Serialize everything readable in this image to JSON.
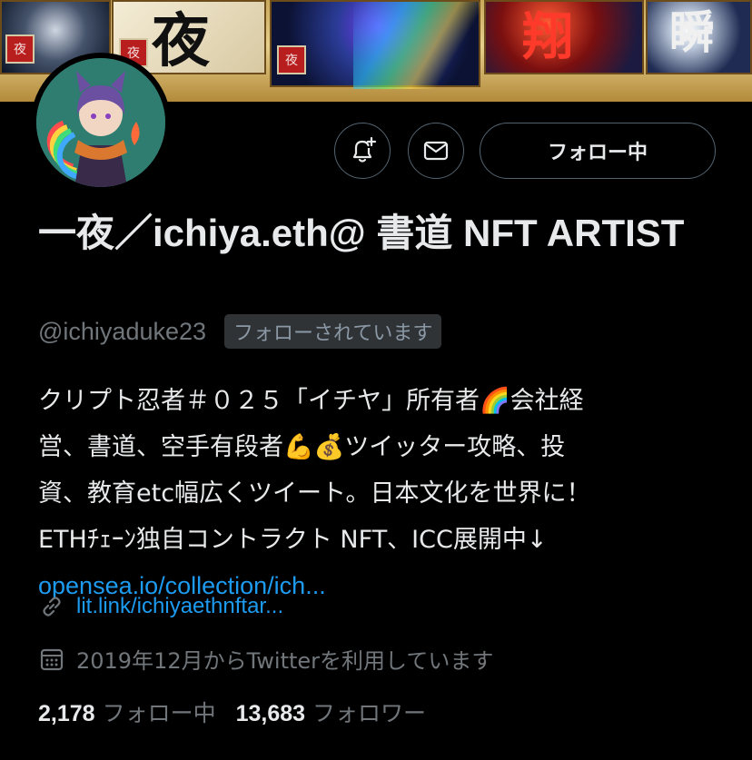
{
  "banner": {
    "glyphs": [
      "夜",
      "翔",
      "瞬"
    ],
    "seal_text": "夜"
  },
  "actions": {
    "notify_icon": "bell-plus-icon",
    "message_icon": "envelope-icon",
    "follow_label": "フォロー中"
  },
  "profile": {
    "name": "一夜／ichiya.eth@ 書道 NFT ARTIST",
    "handle": "@ichiyaduke23",
    "follows_you": "フォローされています",
    "bio_lines": [
      "クリプト忍者＃０２５「イチヤ」所有者🌈会社経",
      "営、書道、空手有段者💪💰ツイッター攻略、投",
      "資、教育etc幅広くツイート。日本文化を世界に！",
      "ETHﾁｪｰﾝ独自コントラクト NFT、ICC展開中↓"
    ],
    "bio_link": "opensea.io/collection/ich...",
    "website": "lit.link/ichiyaethnftar...",
    "joined": "2019年12月からTwitterを利用しています"
  },
  "stats": {
    "following_count": "2,178",
    "following_label": "フォロー中",
    "followers_count": "13,683",
    "followers_label": "フォロワー"
  },
  "colors": {
    "background": "#000000",
    "text": "#e7e9ea",
    "secondary": "#71767b",
    "link": "#1d9bf0",
    "border": "#536471"
  }
}
